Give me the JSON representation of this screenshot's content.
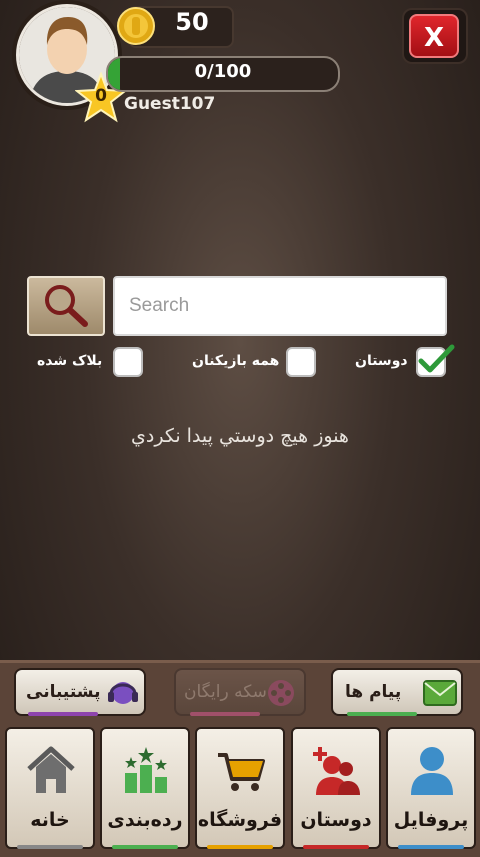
{
  "header": {
    "coins": "50",
    "level": "0",
    "xp_text": "0/100",
    "xp_fraction": 0.05,
    "username": "Guest107",
    "close_label": "X"
  },
  "search": {
    "placeholder": "Search",
    "value": ""
  },
  "filters": [
    {
      "label": "دوستان",
      "checked": true
    },
    {
      "label": "همه بازیکنان",
      "checked": false
    },
    {
      "label": "بلاک شده",
      "checked": false
    }
  ],
  "empty_message": "هنوز هيچ دوستي پيدا نکردي",
  "action_buttons": [
    {
      "label": "پیام ها",
      "icon": "envelope-icon",
      "accent": "#4caf50",
      "enabled": true
    },
    {
      "label": "سکه رایگان",
      "icon": "film-reel-icon",
      "accent": "#a0506a",
      "enabled": false
    },
    {
      "label": "پشتیبانی",
      "icon": "headset-icon",
      "accent": "#8e44ad",
      "enabled": true
    }
  ],
  "tabs": [
    {
      "label": "پروفایل",
      "icon": "user-icon",
      "accent": "#3d8ec9"
    },
    {
      "label": "دوستان",
      "icon": "add-friend-icon",
      "accent": "#c62828"
    },
    {
      "label": "فروشگاه",
      "icon": "cart-icon",
      "accent": "#e6a100"
    },
    {
      "label": "رده‌بندی",
      "icon": "leaderboard-icon",
      "accent": "#4caf50"
    },
    {
      "label": "خانه",
      "icon": "home-icon",
      "accent": "#888888"
    }
  ]
}
